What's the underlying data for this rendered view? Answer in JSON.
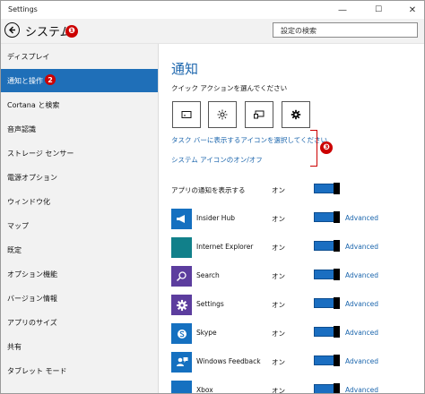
{
  "window": {
    "title": "Settings",
    "minimize": "—",
    "maximize": "☐",
    "close": "✕"
  },
  "header": {
    "page_title": "システム",
    "search_placeholder": "設定の検索"
  },
  "callouts": {
    "c1": "❶",
    "c2": "2",
    "c3": "❸"
  },
  "sidebar": {
    "items": [
      {
        "label": "ディスプレイ",
        "selected": false
      },
      {
        "label": "通知と操作",
        "selected": true
      },
      {
        "label": "Cortana と検索",
        "selected": false
      },
      {
        "label": "音声認識",
        "selected": false
      },
      {
        "label": "ストレージ センサー",
        "selected": false
      },
      {
        "label": "電源オプション",
        "selected": false
      },
      {
        "label": "ウィンドウ化",
        "selected": false
      },
      {
        "label": "マップ",
        "selected": false
      },
      {
        "label": "既定",
        "selected": false
      },
      {
        "label": "オプション機能",
        "selected": false
      },
      {
        "label": "バージョン情報",
        "selected": false
      },
      {
        "label": "アプリのサイズ",
        "selected": false
      },
      {
        "label": "共有",
        "selected": false
      },
      {
        "label": "タブレット モード",
        "selected": false
      }
    ]
  },
  "main": {
    "section_title": "通知",
    "quick_actions_label": "クイック アクションを選んでください",
    "quick_actions": [
      {
        "icon": "tablet-mode-icon"
      },
      {
        "icon": "brightness-icon"
      },
      {
        "icon": "connect-icon"
      },
      {
        "icon": "settings-gear-icon"
      }
    ],
    "links": {
      "taskbar_icons": "タスク バーに表示するアイコンを選択してください",
      "system_icons": "システム アイコンのオン/オフ"
    },
    "show_notifications": {
      "label": "アプリの通知を表示する",
      "state": "オン"
    },
    "apps": [
      {
        "name": "Insider Hub",
        "state": "オン",
        "advanced": "Advanced",
        "color": "#1570c0",
        "icon": "megaphone-icon"
      },
      {
        "name": "Internet Explorer",
        "state": "オン",
        "advanced": "Advanced",
        "color": "#11808a",
        "icon": ""
      },
      {
        "name": "Search",
        "state": "オン",
        "advanced": "Advanced",
        "color": "#5c3d9e",
        "icon": "search-icon"
      },
      {
        "name": "Settings",
        "state": "オン",
        "advanced": "Advanced",
        "color": "#5c3d9e",
        "icon": "gear-icon"
      },
      {
        "name": "Skype",
        "state": "オン",
        "advanced": "Advanced",
        "color": "#1570c0",
        "icon": "skype-icon"
      },
      {
        "name": "Windows Feedback",
        "state": "オン",
        "advanced": "Advanced",
        "color": "#1570c0",
        "icon": "feedback-icon"
      },
      {
        "name": "Xbox",
        "state": "オン",
        "advanced": "Advanced",
        "color": "#1570c0",
        "icon": ""
      }
    ]
  }
}
